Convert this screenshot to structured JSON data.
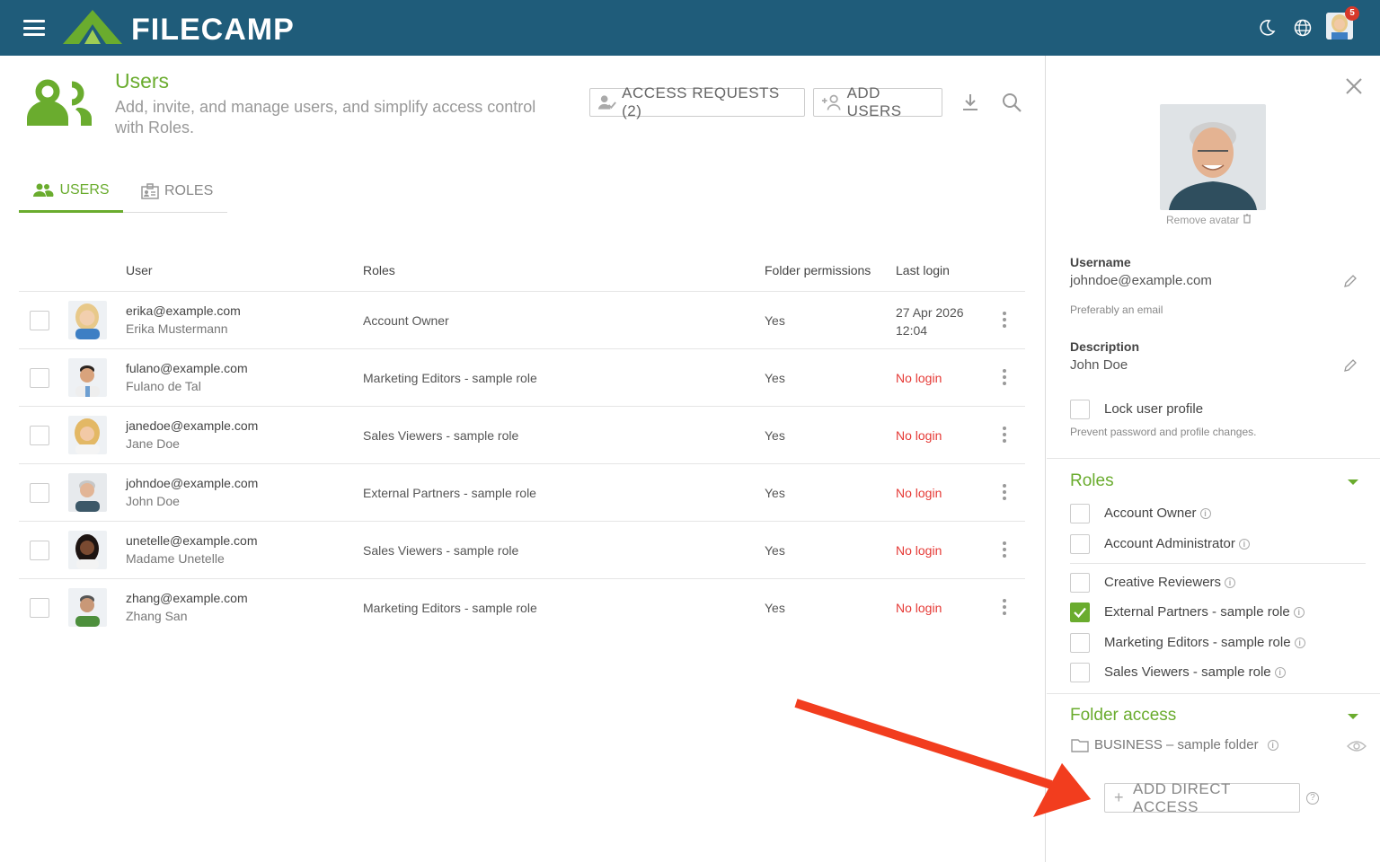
{
  "app": {
    "name": "FILECAMP",
    "notification_count": "5"
  },
  "header": {
    "title": "Users",
    "subtitle": "Add, invite, and manage users, and simplify access control with Roles.",
    "access_requests_label": "ACCESS REQUESTS (2)",
    "add_users_label": "ADD USERS"
  },
  "tabs": [
    {
      "label": "USERS",
      "active": true
    },
    {
      "label": "ROLES",
      "active": false
    }
  ],
  "table": {
    "columns": [
      "User",
      "Roles",
      "Folder permissions",
      "Last login"
    ],
    "rows": [
      {
        "email": "erika@example.com",
        "name": "Erika Mustermann",
        "role": "Account Owner",
        "permissions": "Yes",
        "last_login": "27 Apr 2026",
        "last_login_time": "12:04"
      },
      {
        "email": "fulano@example.com",
        "name": "Fulano de Tal",
        "role": "Marketing Editors - sample role",
        "permissions": "Yes",
        "last_login": "No login"
      },
      {
        "email": "janedoe@example.com",
        "name": "Jane Doe",
        "role": "Sales Viewers - sample role",
        "permissions": "Yes",
        "last_login": "No login"
      },
      {
        "email": "johndoe@example.com",
        "name": "John Doe",
        "role": "External Partners - sample role",
        "permissions": "Yes",
        "last_login": "No login"
      },
      {
        "email": "unetelle@example.com",
        "name": "Madame Unetelle",
        "role": "Sales Viewers - sample role",
        "permissions": "Yes",
        "last_login": "No login"
      },
      {
        "email": "zhang@example.com",
        "name": "Zhang San",
        "role": "Marketing Editors - sample role",
        "permissions": "Yes",
        "last_login": "No login"
      }
    ]
  },
  "panel": {
    "remove_avatar": "Remove avatar",
    "username_label": "Username",
    "username_value": "johndoe@example.com",
    "username_hint": "Preferably an email",
    "description_label": "Description",
    "description_value": "John Doe",
    "lock_label": "Lock user profile",
    "lock_hint": "Prevent password and profile changes.",
    "roles_title": "Roles",
    "roles": [
      {
        "label": "Account Owner",
        "checked": false
      },
      {
        "label": "Account Administrator",
        "checked": false
      },
      {
        "label": "Creative Reviewers",
        "checked": false
      },
      {
        "label": "External Partners - sample role",
        "checked": true
      },
      {
        "label": "Marketing Editors - sample role",
        "checked": false
      },
      {
        "label": "Sales Viewers - sample role",
        "checked": false
      }
    ],
    "folder_access_title": "Folder access",
    "folder": "BUSINESS – sample folder",
    "add_direct_access": "ADD DIRECT ACCESS"
  },
  "colors": {
    "topbar": "#1f5c7a",
    "accent": "#6aac2e",
    "no_login": "#e53935",
    "annotation_arrow": "#f23d1e"
  }
}
